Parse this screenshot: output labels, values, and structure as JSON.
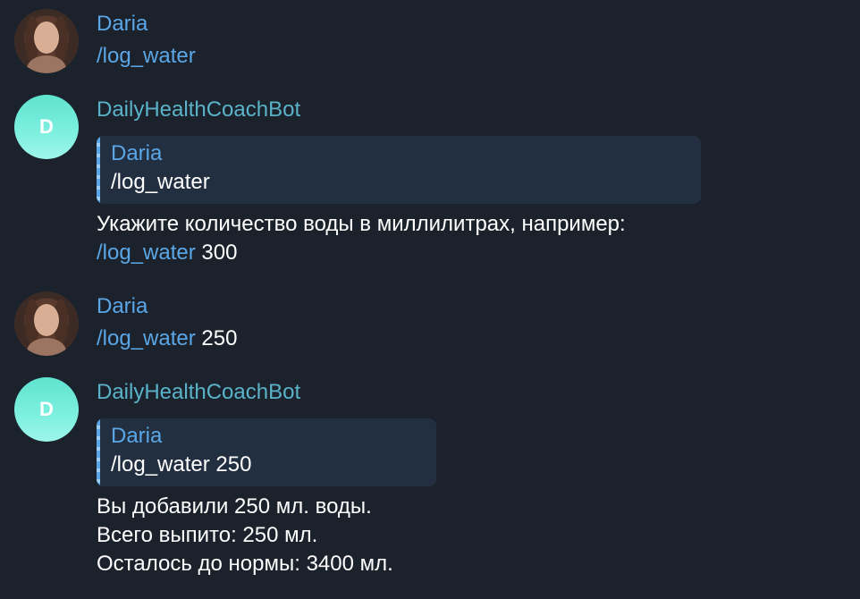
{
  "messages": [
    {
      "sender": "Daria",
      "command": "/log_water",
      "arg": ""
    },
    {
      "sender": "DailyHealthCoachBot",
      "avatar_letter": "D",
      "quote_author": "Daria",
      "quote_text": "/log_water",
      "lines": [
        "Укажите количество воды в миллилитрах, например:"
      ],
      "example_command": "/log_water",
      "example_arg": " 300"
    },
    {
      "sender": "Daria",
      "command": "/log_water",
      "arg": " 250"
    },
    {
      "sender": "DailyHealthCoachBot",
      "avatar_letter": "D",
      "quote_author": "Daria",
      "quote_text": "/log_water 250",
      "lines": [
        "Вы добавили 250 мл. воды.",
        "Всего выпито: 250 мл.",
        "Осталось до нормы: 3400 мл."
      ]
    }
  ],
  "colors": {
    "background": "#1b222c",
    "user_name": "#5aa6e6",
    "bot_name": "#5ab3c9",
    "command_link": "#5aa6e6",
    "quote_bg": "#222f40",
    "bot_avatar": "#6feadb"
  }
}
